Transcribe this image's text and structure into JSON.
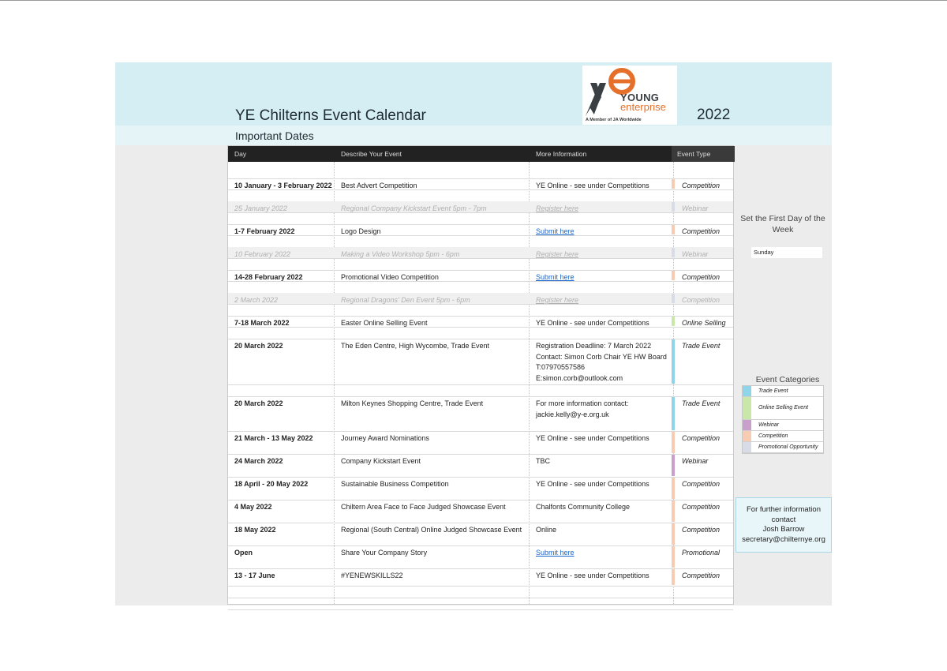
{
  "header": {
    "title": "YE Chilterns Event Calendar",
    "subtitle": "Important Dates",
    "year": "2022",
    "logo": {
      "word1": "YOUNG",
      "word2": "enterprise",
      "tagline": "A Member of JA Worldwide",
      "letters": "YE"
    }
  },
  "colors": {
    "trade": "#8fd4e8",
    "online": "#c9e7a9",
    "webinar": "#c9a0cc",
    "competition": "#f6cdb3",
    "promotional": "#d8dce6"
  },
  "table": {
    "columns": [
      "Day",
      "Describe Your Event",
      "More Information",
      "Event Type"
    ],
    "rows": [
      {
        "day": "10 January - 3 February 2022",
        "event": "Best Advert Competition",
        "info": [
          "YE Online - see under Competitions"
        ],
        "type": "Competition",
        "cat": "competition"
      },
      {
        "day": "25 January 2022",
        "event": "Regional Company Kickstart Event 5pm - 7pm",
        "info": [
          "Register here"
        ],
        "type": "Webinar",
        "cat": "promotional",
        "muted": true,
        "link": true
      },
      {
        "day": "1-7 February 2022",
        "event": "Logo Design",
        "info": [
          "Submit here"
        ],
        "type": "Competition",
        "cat": "competition",
        "link": true
      },
      {
        "day": "10 February 2022",
        "event": "Making a Video Workshop 5pm - 6pm",
        "info": [
          "Register here"
        ],
        "type": "Webinar",
        "cat": "promotional",
        "muted": true,
        "link": true
      },
      {
        "day": "14-28 February 2022",
        "event": "Promotional Video Competition",
        "info": [
          "Submit here"
        ],
        "type": "Competition",
        "cat": "competition",
        "link": true
      },
      {
        "day": "2 March 2022",
        "event": "Regional Dragons' Den Event 5pm - 6pm",
        "info": [
          "Register here"
        ],
        "type": "Competition",
        "cat": "promotional",
        "muted": true,
        "link": true
      },
      {
        "day": "7-18 March 2022",
        "event": "Easter Online Selling Event",
        "info": [
          "YE Online - see under Competitions"
        ],
        "type": "Online Selling",
        "cat": "online"
      },
      {
        "day": "20 March 2022",
        "event": "The Eden Centre, High Wycombe, Trade Event",
        "info": [
          "Registration Deadline:  7 March 2022",
          "Contact:  Simon Corb Chair YE HW Board",
          "T:07970557586",
          "E:simon.corb@outlook.com"
        ],
        "type": "Trade Event",
        "cat": "trade"
      },
      {
        "day": "20 March 2022",
        "event": "Milton Keynes Shopping Centre, Trade Event",
        "info": [
          "For more information contact:",
          "jackie.kelly@y-e.org.uk"
        ],
        "type": "Trade Event",
        "cat": "trade"
      },
      {
        "day": "21 March - 13 May 2022",
        "event": "Journey Award Nominations",
        "info": [
          "YE Online - see under Competitions"
        ],
        "type": "Competition",
        "cat": "competition"
      },
      {
        "day": "24 March 2022",
        "event": "Company Kickstart Event",
        "info": [
          "TBC"
        ],
        "type": "Webinar",
        "cat": "webinar"
      },
      {
        "day": "18 April - 20 May 2022",
        "event": "Sustainable Business Competition",
        "info": [
          "YE Online - see under Competitions"
        ],
        "type": "Competition",
        "cat": "competition"
      },
      {
        "day": "4 May 2022",
        "event": "Chiltern Area Face to Face Judged  Showcase Event",
        "info": [
          "Chalfonts Community College"
        ],
        "type": "Competition",
        "cat": "competition"
      },
      {
        "day": "18 May 2022",
        "event": "Regional (South Central) Online Judged Showcase Event",
        "info": [
          "Online"
        ],
        "type": "Competition",
        "cat": "competition"
      },
      {
        "day": "Open",
        "event": "Share Your Company Story",
        "info": [
          "Submit here"
        ],
        "type": "Promotional",
        "cat": "competition",
        "link": true
      },
      {
        "day": "13 - 17 June",
        "event": "#YENEWSKILLS22",
        "info": [
          "YE Online - see under Competitions"
        ],
        "type": "Competition",
        "cat": "competition"
      }
    ]
  },
  "side": {
    "first_day_label": "Set the First Day of the Week",
    "first_day_value": "Sunday",
    "categories_title": "Event Categories",
    "categories": [
      {
        "label": "Trade Event",
        "cat": "trade"
      },
      {
        "label": "Online Selling Event",
        "cat": "online"
      },
      {
        "label": "Webinar",
        "cat": "webinar"
      },
      {
        "label": "Competition",
        "cat": "competition"
      },
      {
        "label": "Promotional Opportunity",
        "cat": "promotional"
      }
    ],
    "contact": {
      "line1": "For further information",
      "line2": "contact",
      "line3": "Josh Barrow",
      "line4": "secretary@chilternye.org"
    }
  }
}
